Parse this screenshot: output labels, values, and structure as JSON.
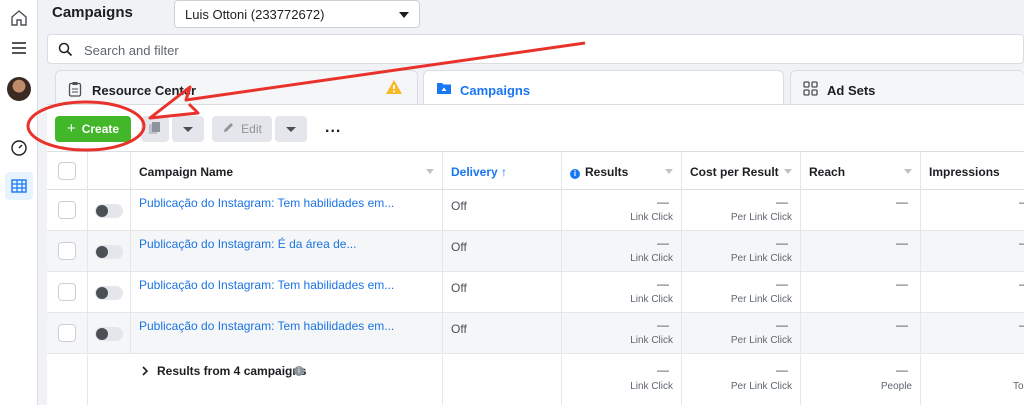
{
  "header": {
    "title": "Campaigns",
    "account_selector": "Luis Ottoni (233772672)"
  },
  "search": {
    "placeholder": "Search and filter"
  },
  "tabs": [
    {
      "label": "Resource Center"
    },
    {
      "label": "Campaigns"
    },
    {
      "label": "Ad Sets"
    }
  ],
  "toolbar": {
    "create_label": "Create",
    "edit_label": "Edit",
    "more_label": "..."
  },
  "table": {
    "columns": {
      "campaign_name": "Campaign Name",
      "delivery": "Delivery",
      "delivery_sort_icon": "↑",
      "results": "Results",
      "cost_per_result": "Cost per Result",
      "reach": "Reach",
      "impressions": "Impressions"
    },
    "rows": [
      {
        "name": "Publicação do Instagram: Tem habilidades em...",
        "delivery": "Off",
        "results": "—",
        "results_sub": "Link Click",
        "cost": "—",
        "cost_sub": "Per Link Click",
        "reach": "—",
        "impressions": "—"
      },
      {
        "name": "Publicação do Instagram: É da área de...",
        "delivery": "Off",
        "results": "—",
        "results_sub": "Link Click",
        "cost": "—",
        "cost_sub": "Per Link Click",
        "reach": "—",
        "impressions": "—"
      },
      {
        "name": "Publicação do Instagram: Tem habilidades em...",
        "delivery": "Off",
        "results": "—",
        "results_sub": "Link Click",
        "cost": "—",
        "cost_sub": "Per Link Click",
        "reach": "—",
        "impressions": "—"
      },
      {
        "name": "Publicação do Instagram: Tem habilidades em...",
        "delivery": "Off",
        "results": "—",
        "results_sub": "Link Click",
        "cost": "—",
        "cost_sub": "Per Link Click",
        "reach": "—",
        "impressions": "—"
      }
    ],
    "summary": {
      "label": "Results from 4 campaigns",
      "results": "—",
      "results_sub": "Link Click",
      "cost": "—",
      "cost_sub": "Per Link Click",
      "reach": "—",
      "reach_sub": "People",
      "impressions_sub": "To"
    }
  },
  "colors": {
    "create_button": "#42b72a",
    "link": "#1b74e4",
    "accent": "#1877f2",
    "annotation": "#e8322b"
  },
  "icons": [
    "home-icon",
    "menu-icon",
    "speedometer-icon",
    "table-grid-icon",
    "search-icon",
    "clipboard-icon",
    "warning-icon",
    "folder-icon",
    "grid-icon",
    "duplicate-icon",
    "pencil-icon",
    "info-icon",
    "chevron-right-icon"
  ]
}
